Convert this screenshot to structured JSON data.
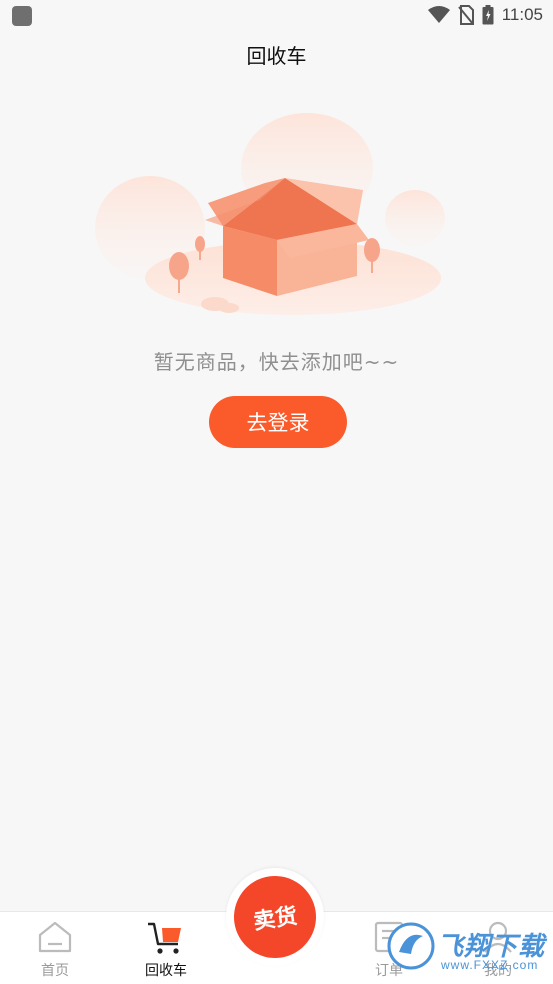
{
  "status_bar": {
    "time": "11:05"
  },
  "header": {
    "title": "回收车"
  },
  "empty_state": {
    "message": "暂无商品，快去添加吧~~",
    "login_button": "去登录"
  },
  "tabbar": {
    "tabs": [
      {
        "label": "首页",
        "icon": "home-icon"
      },
      {
        "label": "回收车",
        "icon": "cart-icon",
        "active": true
      },
      {
        "label": "订单",
        "icon": "order-icon"
      },
      {
        "label": "我的",
        "icon": "user-icon"
      }
    ],
    "sell_button": "卖货"
  },
  "watermark": {
    "main": "飞翔下载",
    "sub": "www.FXXZ.com"
  },
  "colors": {
    "accent": "#fb5a2a",
    "sell": "#f4472a",
    "background": "#f7f7f7"
  }
}
